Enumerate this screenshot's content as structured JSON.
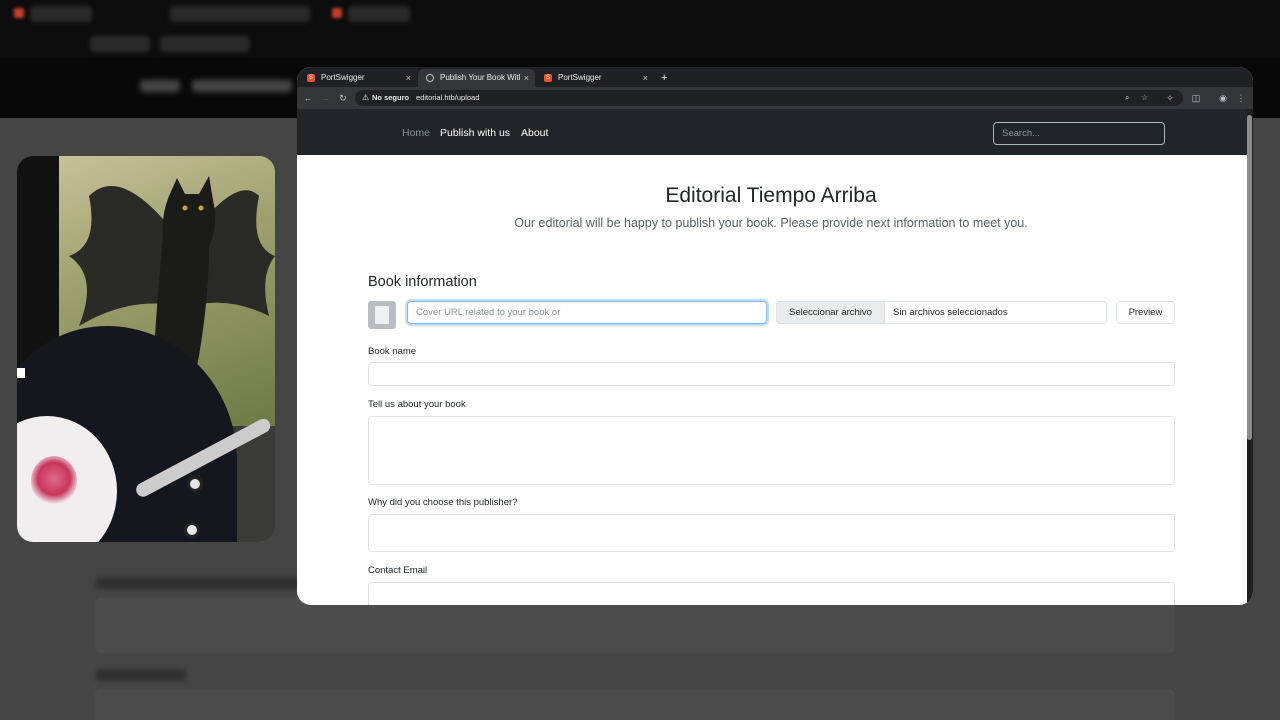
{
  "browser": {
    "tabs": [
      {
        "title": "PortSwigger",
        "favicon": "portswigger-logo",
        "active": false
      },
      {
        "title": "Publish Your Book With",
        "favicon": "globe-icon",
        "active": true
      },
      {
        "title": "PortSwigger",
        "favicon": "portswigger-logo",
        "active": false
      }
    ],
    "tab_close_glyph": "×",
    "new_tab_glyph": "+",
    "toolbar": {
      "back_glyph": "←",
      "forward_glyph": "→",
      "reload_glyph": "↻",
      "security_warning_glyph": "⚠",
      "security_label": "No seguro",
      "url": "editorial.htb/upload",
      "zoom_glyph": "⌕",
      "star_glyph": "☆",
      "extensions_glyph": "✧",
      "sidepanel_glyph": "◫",
      "profile_glyph": "◉",
      "menu_glyph": "⋮"
    }
  },
  "site": {
    "nav": {
      "home": "Home",
      "publish": "Publish with us",
      "about": "About",
      "search_placeholder": "Search..."
    },
    "title": "Editorial Tiempo Arriba",
    "subtitle": "Our editorial will be happy to publish your book. Please provide next information to meet you.",
    "book_info": {
      "heading": "Book information",
      "cover_url_placeholder": "Cover URL related to your book or",
      "file_button": "Seleccionar archivo",
      "file_status": "Sin archivos seleccionados",
      "preview_button": "Preview"
    },
    "fields": {
      "book_name": "Book name",
      "about_book": "Tell us about your book",
      "why_publisher": "Why did you choose this publisher?",
      "contact_email": "Contact Email"
    }
  }
}
